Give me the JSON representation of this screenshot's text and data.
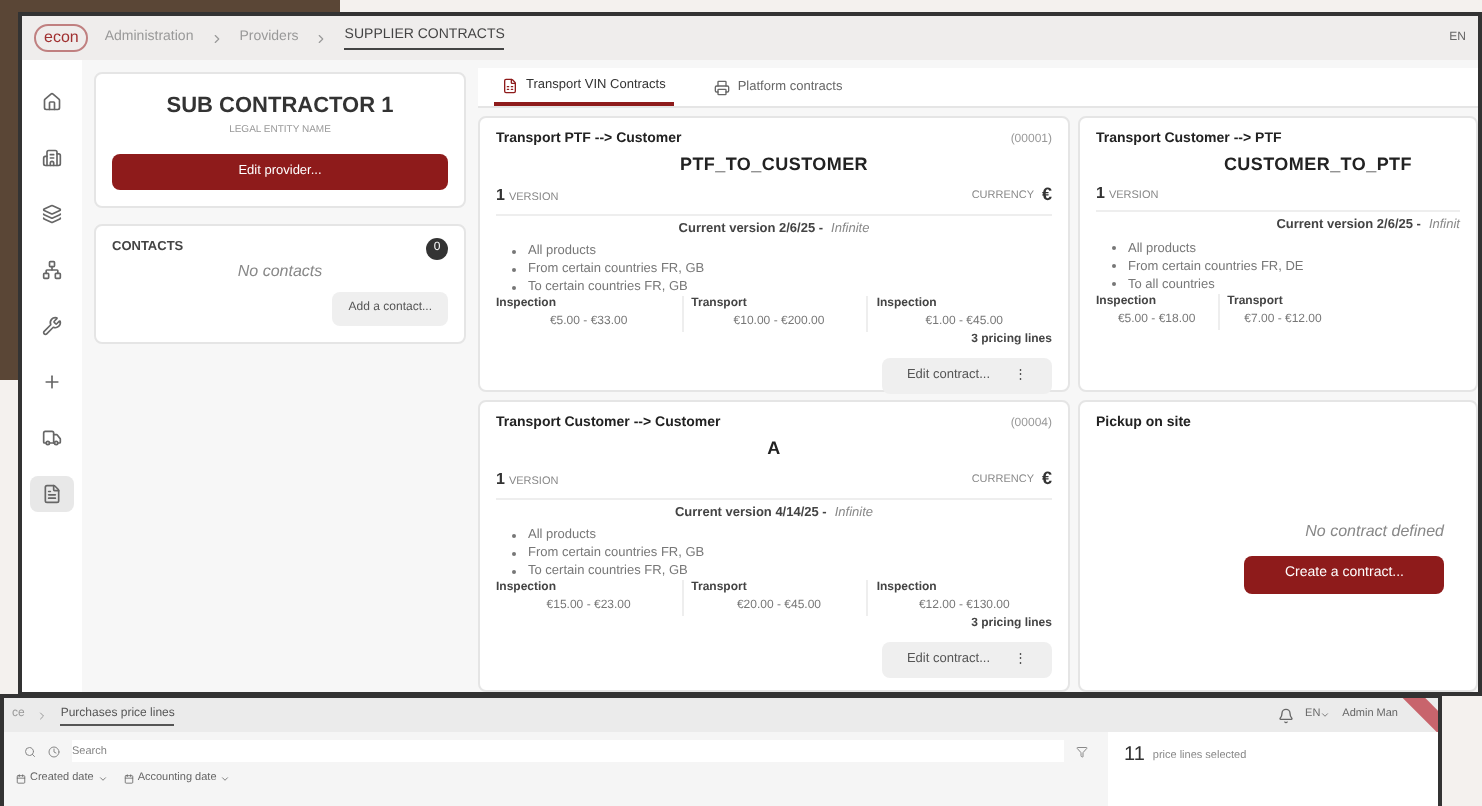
{
  "main_window": {
    "logo": "econ",
    "breadcrumb": [
      {
        "label": "Administration",
        "selected": false
      },
      {
        "label": "Providers",
        "selected": false
      },
      {
        "label": "SUPPLIER CONTRACTS",
        "selected": true
      }
    ],
    "language": "EN",
    "sidebar": {
      "items": [
        {
          "selected": false
        },
        {
          "selected": false
        },
        {
          "selected": false
        },
        {
          "selected": false
        },
        {
          "selected": false
        },
        {
          "selected": false
        },
        {
          "selected": false
        },
        {
          "selected": true
        }
      ]
    },
    "provider": {
      "name": "SUB CONTRACTOR 1",
      "subtitle": "LEGAL ENTITY NAME",
      "edit_button": "Edit provider..."
    },
    "contacts": {
      "title": "CONTACTS",
      "count": "0",
      "empty_text": "No contacts",
      "add_button": "Add a contact..."
    },
    "tabs": [
      {
        "label": "Transport VIN Contracts",
        "selected": true
      },
      {
        "label": "Platform contracts",
        "selected": false
      }
    ],
    "cards": [
      {
        "kind": "contract",
        "title": "Transport PTF --> Customer",
        "code": "(00001)",
        "name": "PTF_TO_CUSTOMER",
        "version_count": "1",
        "version_label": "VERSION",
        "currency_label": "CURRENCY",
        "currency": "€",
        "current_version": "Current version 2/6/25 -",
        "validity": "Infinite",
        "conditions": [
          "All products",
          "From certain countries FR, GB",
          "To certain countries FR, GB"
        ],
        "pricing": [
          {
            "label": "Inspection",
            "range": "€5.00 - €33.00"
          },
          {
            "label": "Transport",
            "range": "€10.00 - €200.00"
          },
          {
            "label": "Inspection",
            "range": "€1.00 - €45.00"
          }
        ],
        "pricing_lines": "3 pricing lines",
        "edit_button": "Edit contract...",
        "menu": "⋮"
      },
      {
        "kind": "contract",
        "title": "Transport Customer --> PTF",
        "name": "CUSTOMER_TO_PTF",
        "version_count": "1",
        "version_label": "VERSION",
        "current_version": "Current version 2/6/25 -",
        "validity": "Infinit",
        "conditions": [
          "All products",
          "From certain countries FR, DE",
          "To all countries"
        ],
        "pricing": [
          {
            "label": "Inspection",
            "range": "€5.00 - €18.00"
          },
          {
            "label": "Transport",
            "range": "€7.00 - €12.00"
          }
        ]
      },
      {
        "kind": "contract",
        "title": "Transport Customer --> Customer",
        "code": "(00004)",
        "name": "A",
        "version_count": "1",
        "version_label": "VERSION",
        "currency_label": "CURRENCY",
        "currency": "€",
        "current_version": "Current version 4/14/25 -",
        "validity": "Infinite",
        "conditions": [
          "All products",
          "From certain countries FR, GB",
          "To certain countries FR, GB"
        ],
        "pricing": [
          {
            "label": "Inspection",
            "range": "€15.00 - €23.00"
          },
          {
            "label": "Transport",
            "range": "€20.00 - €45.00"
          },
          {
            "label": "Inspection",
            "range": "€12.00 - €130.00"
          }
        ],
        "pricing_lines": "3 pricing lines",
        "edit_button": "Edit contract...",
        "menu": "⋮"
      },
      {
        "kind": "empty",
        "title": "Pickup on site",
        "empty_text": "No contract defined",
        "create_button": "Create a contract..."
      }
    ]
  },
  "back_window": {
    "breadcrumb": [
      {
        "label": "ce",
        "selected": false
      },
      {
        "label": "Purchases price lines",
        "selected": true
      }
    ],
    "language": "EN",
    "user": "Admin Man",
    "search": {
      "placeholder": "Search"
    },
    "filters": [
      "Created date",
      "Accounting date"
    ],
    "selection": {
      "count": "11",
      "label": "price lines selected"
    }
  }
}
